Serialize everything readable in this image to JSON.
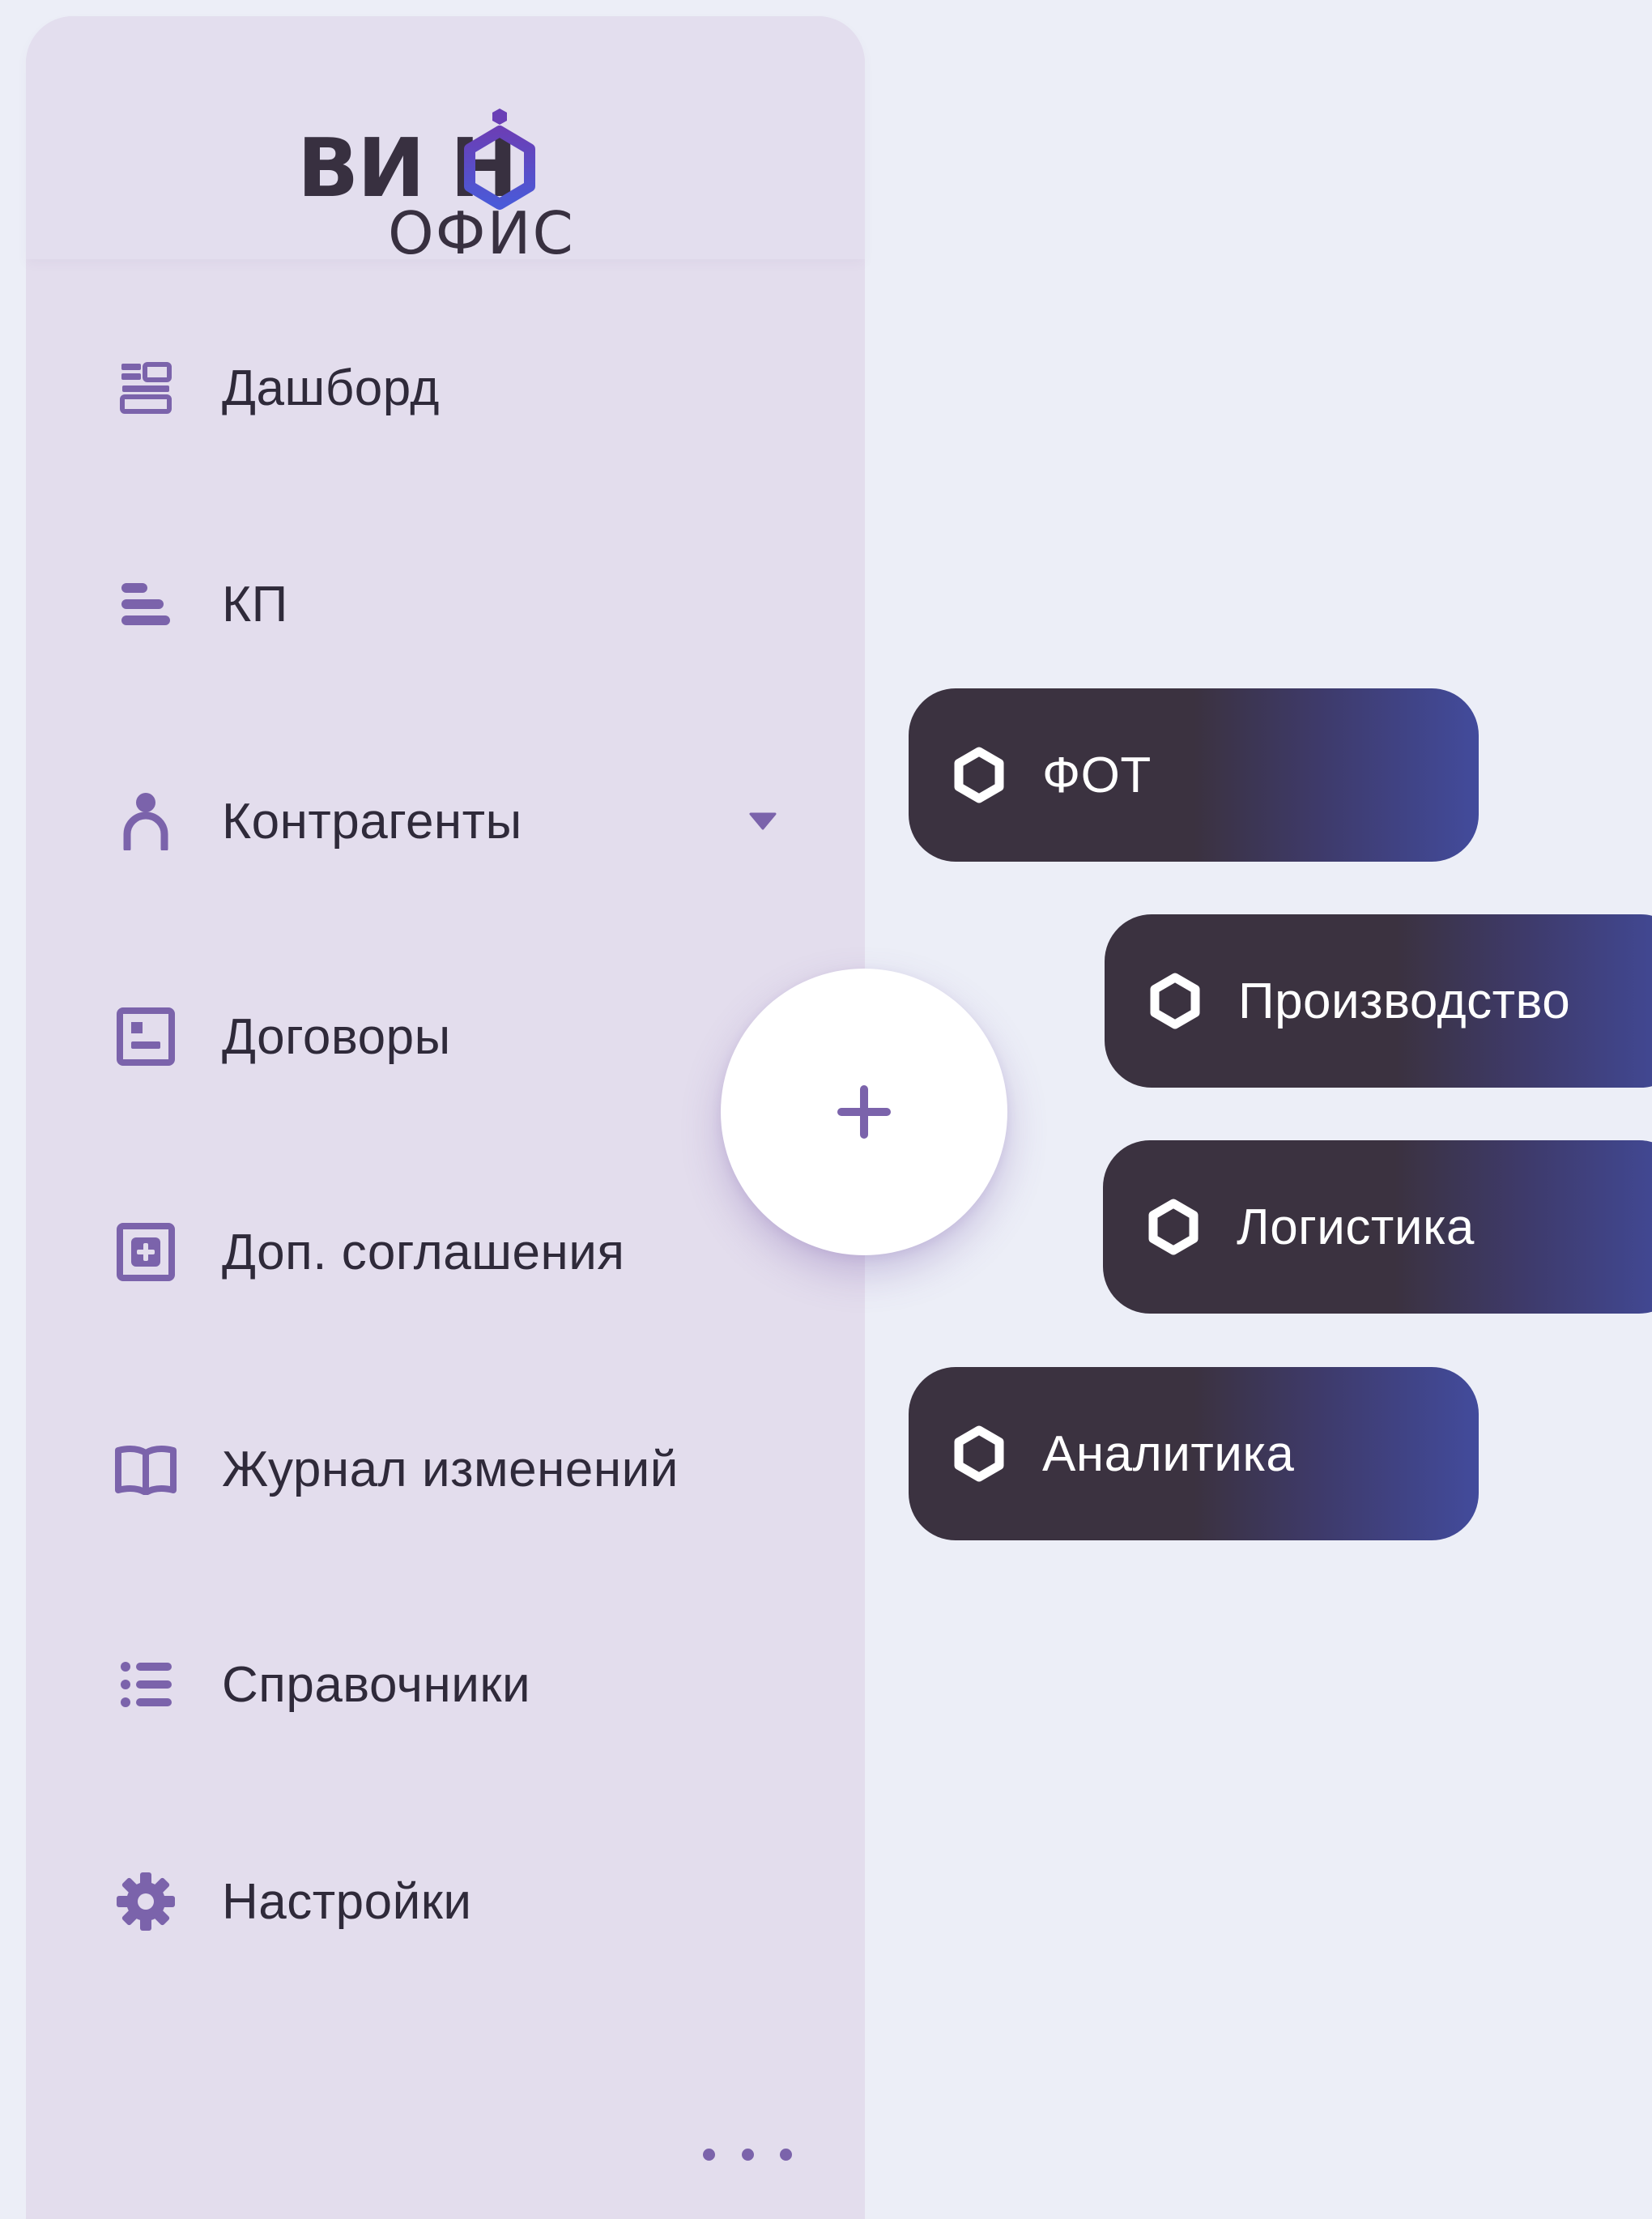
{
  "logo": {
    "word": "ВИ Н",
    "subtitle": "ОФИС"
  },
  "sidebar": {
    "items": [
      {
        "label": "Дашборд",
        "icon": "dashboard-icon"
      },
      {
        "label": "КП",
        "icon": "bars-icon"
      },
      {
        "label": "Контрагенты",
        "icon": "person-icon",
        "has_dropdown": true
      },
      {
        "label": "Договоры",
        "icon": "contract-icon"
      },
      {
        "label": "Доп. соглашения",
        "icon": "add-document-icon"
      },
      {
        "label": "Журнал изменений",
        "icon": "book-icon"
      },
      {
        "label": "Справочники",
        "icon": "list-icon"
      },
      {
        "label": "Настройки",
        "icon": "gear-icon"
      }
    ],
    "more": "more-dots-icon"
  },
  "fab": {
    "icon": "plus-icon"
  },
  "quick_actions": [
    {
      "label": "ФОТ",
      "icon": "hexagon-icon"
    },
    {
      "label": "Производство",
      "icon": "hexagon-icon"
    },
    {
      "label": "Логистика",
      "icon": "hexagon-icon"
    },
    {
      "label": "Аналитика",
      "icon": "hexagon-icon"
    }
  ],
  "colors": {
    "accent": "#7b63ab",
    "sidebar_bg": "#e3dded",
    "page_bg": "#eceef7",
    "pill_dark": "#3b3240",
    "pill_blue": "#424b9c"
  }
}
